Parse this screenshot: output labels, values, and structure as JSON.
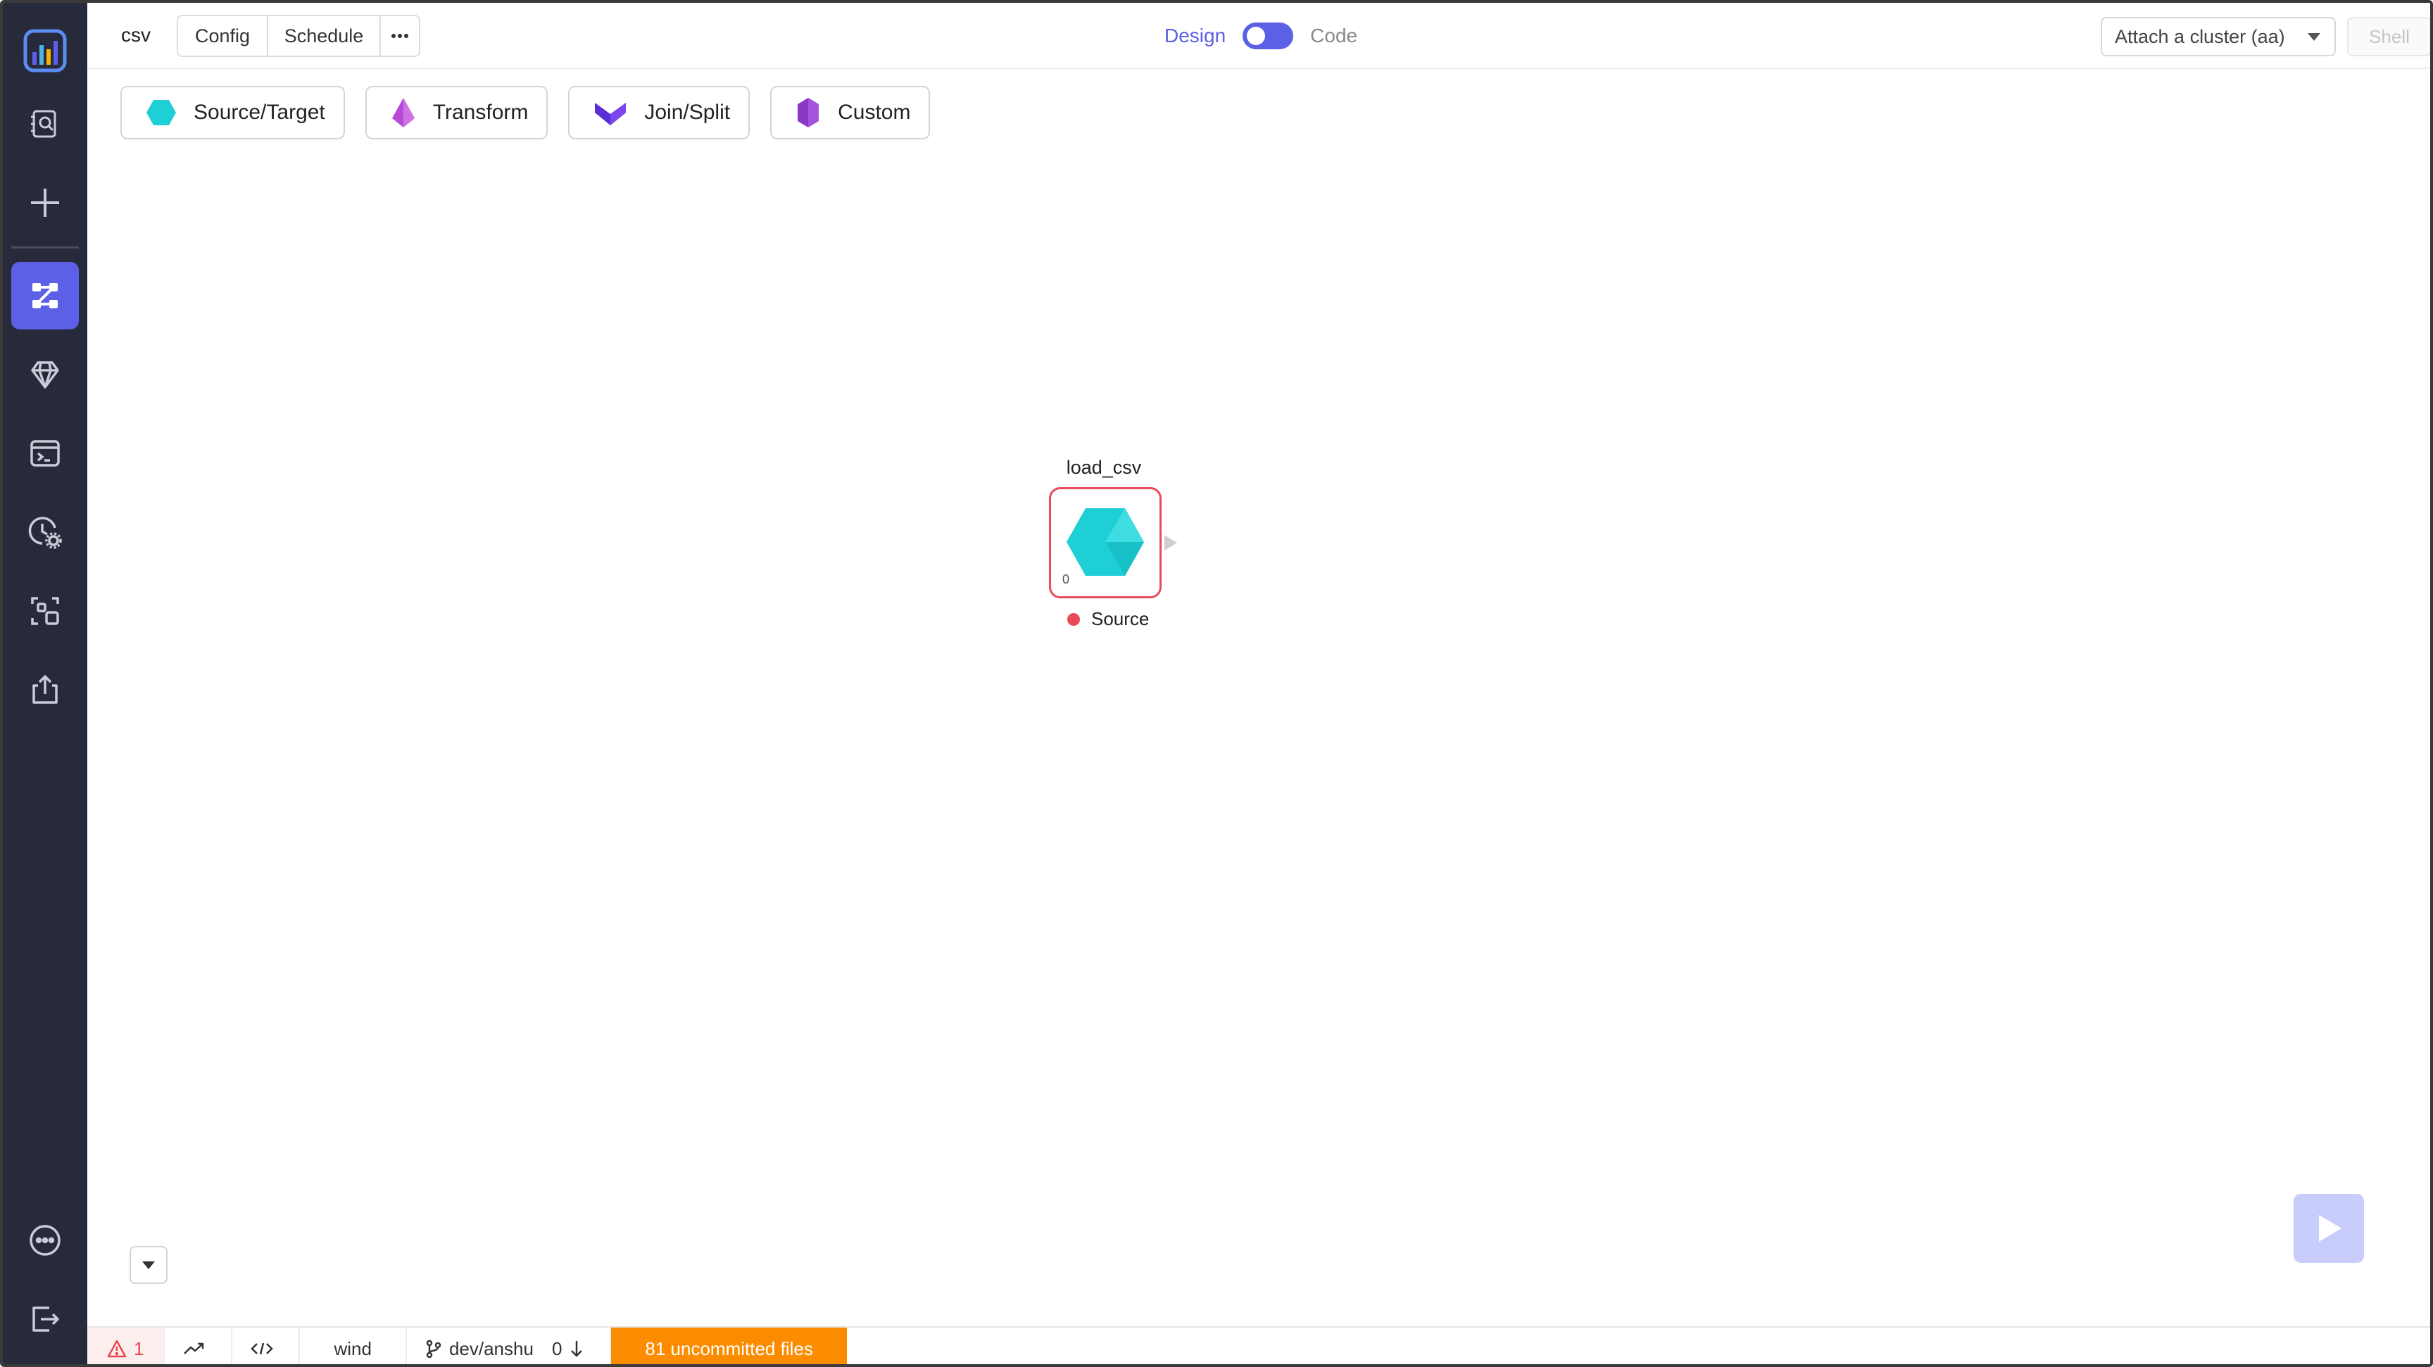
{
  "header": {
    "pipeline_name": "csv",
    "tabs": [
      "Config",
      "Schedule"
    ],
    "more_label": "···",
    "mode_design": "Design",
    "mode_code": "Code",
    "cluster_select": "Attach a cluster (aa)",
    "shell_label": "Shell"
  },
  "palette": {
    "source_target": "Source/Target",
    "transform": "Transform",
    "join_split": "Join/Split",
    "custom": "Custom"
  },
  "canvas": {
    "node": {
      "name": "load_csv",
      "count": "0",
      "type": "Source",
      "status_color": "#ea4a55"
    }
  },
  "footer": {
    "errors": "1",
    "fabric": "wind",
    "branch": "dev/anshu",
    "behind": "0",
    "uncommitted": "81 uncommitted files"
  },
  "colors": {
    "accent": "#5c60e6",
    "sidebar_bg": "#272a3a",
    "warning": "#fb8c00",
    "source_gem": "#1fcfd6"
  },
  "sidebar": {
    "icons": [
      "logo-icon",
      "search-icon",
      "plus-icon",
      "pipeline-icon",
      "gem-icon",
      "terminal-icon",
      "schedule-settings-icon",
      "dependency-icon",
      "export-icon",
      "more-icon",
      "logout-icon"
    ]
  }
}
